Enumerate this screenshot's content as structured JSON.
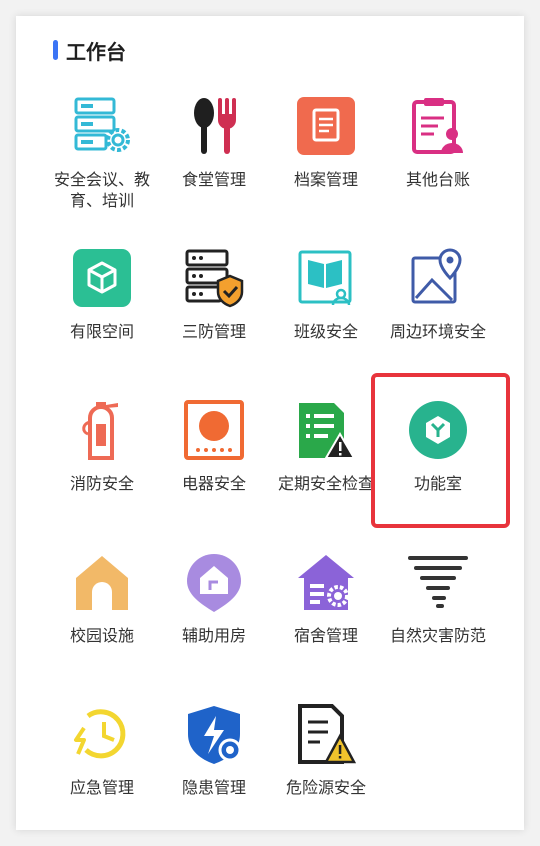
{
  "header": {
    "title": "工作台"
  },
  "items": [
    {
      "label": "安全会议、教育、培训",
      "icon": "server-gear-icon"
    },
    {
      "label": "食堂管理",
      "icon": "spoon-fork-icon"
    },
    {
      "label": "档案管理",
      "icon": "document-icon"
    },
    {
      "label": "其他台账",
      "icon": "clipboard-person-icon"
    },
    {
      "label": "有限空间",
      "icon": "cube-icon"
    },
    {
      "label": "三防管理",
      "icon": "shield-server-icon"
    },
    {
      "label": "班级安全",
      "icon": "book-person-icon"
    },
    {
      "label": "周边环境安全",
      "icon": "map-pin-icon"
    },
    {
      "label": "消防安全",
      "icon": "fire-extinguisher-icon"
    },
    {
      "label": "电器安全",
      "icon": "appliance-icon"
    },
    {
      "label": "定期安全检查",
      "icon": "checklist-warning-icon"
    },
    {
      "label": "功能室",
      "icon": "room-cube-icon"
    },
    {
      "label": "校园设施",
      "icon": "house-icon"
    },
    {
      "label": "辅助用房",
      "icon": "house-pin-icon"
    },
    {
      "label": "宿舍管理",
      "icon": "house-gear-icon"
    },
    {
      "label": "自然灾害防范",
      "icon": "tornado-icon"
    },
    {
      "label": "应急管理",
      "icon": "clock-alert-icon"
    },
    {
      "label": "隐患管理",
      "icon": "shield-bolt-icon"
    },
    {
      "label": "危险源安全",
      "icon": "document-warning-icon"
    }
  ]
}
